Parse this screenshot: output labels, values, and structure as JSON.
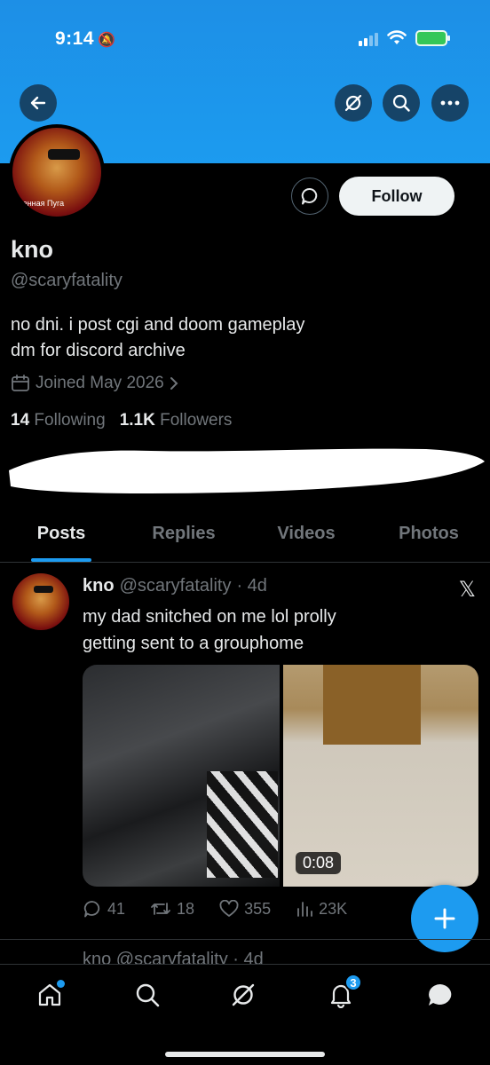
{
  "status_bar": {
    "time": "9:14"
  },
  "profile": {
    "name": "kno",
    "handle": "@scaryfatality",
    "bio_line1": "no dni. i post cgi and doom gameplay",
    "bio_line2": "dm for discord archive",
    "joined": "Joined May 2026",
    "following_count": "14",
    "following_label": "Following",
    "followers_count": "1.1K",
    "followers_label": "Followers",
    "follow_button": "Follow",
    "avatar_text": "rченная Пуга"
  },
  "tabs": [
    {
      "label": "Posts",
      "active": true
    },
    {
      "label": "Replies",
      "active": false
    },
    {
      "label": "Videos",
      "active": false
    },
    {
      "label": "Photos",
      "active": false
    }
  ],
  "tweet": {
    "name": "kno",
    "handle": "@scaryfatality",
    "time": "· 4d",
    "text_line1": "my dad snitched on me lol prolly",
    "text_line2": "getting sent to a grouphome",
    "video_duration": "0:08",
    "replies": "41",
    "retweets": "18",
    "likes": "355",
    "views": "23K"
  },
  "peek_tweet": {
    "text": "kno @scaryfatality · 4d"
  },
  "nav": {
    "notifications_badge": "3"
  },
  "colors": {
    "accent": "#1d9bf0",
    "banner": "#1c9bef",
    "background": "#000000",
    "muted": "#71767b"
  }
}
